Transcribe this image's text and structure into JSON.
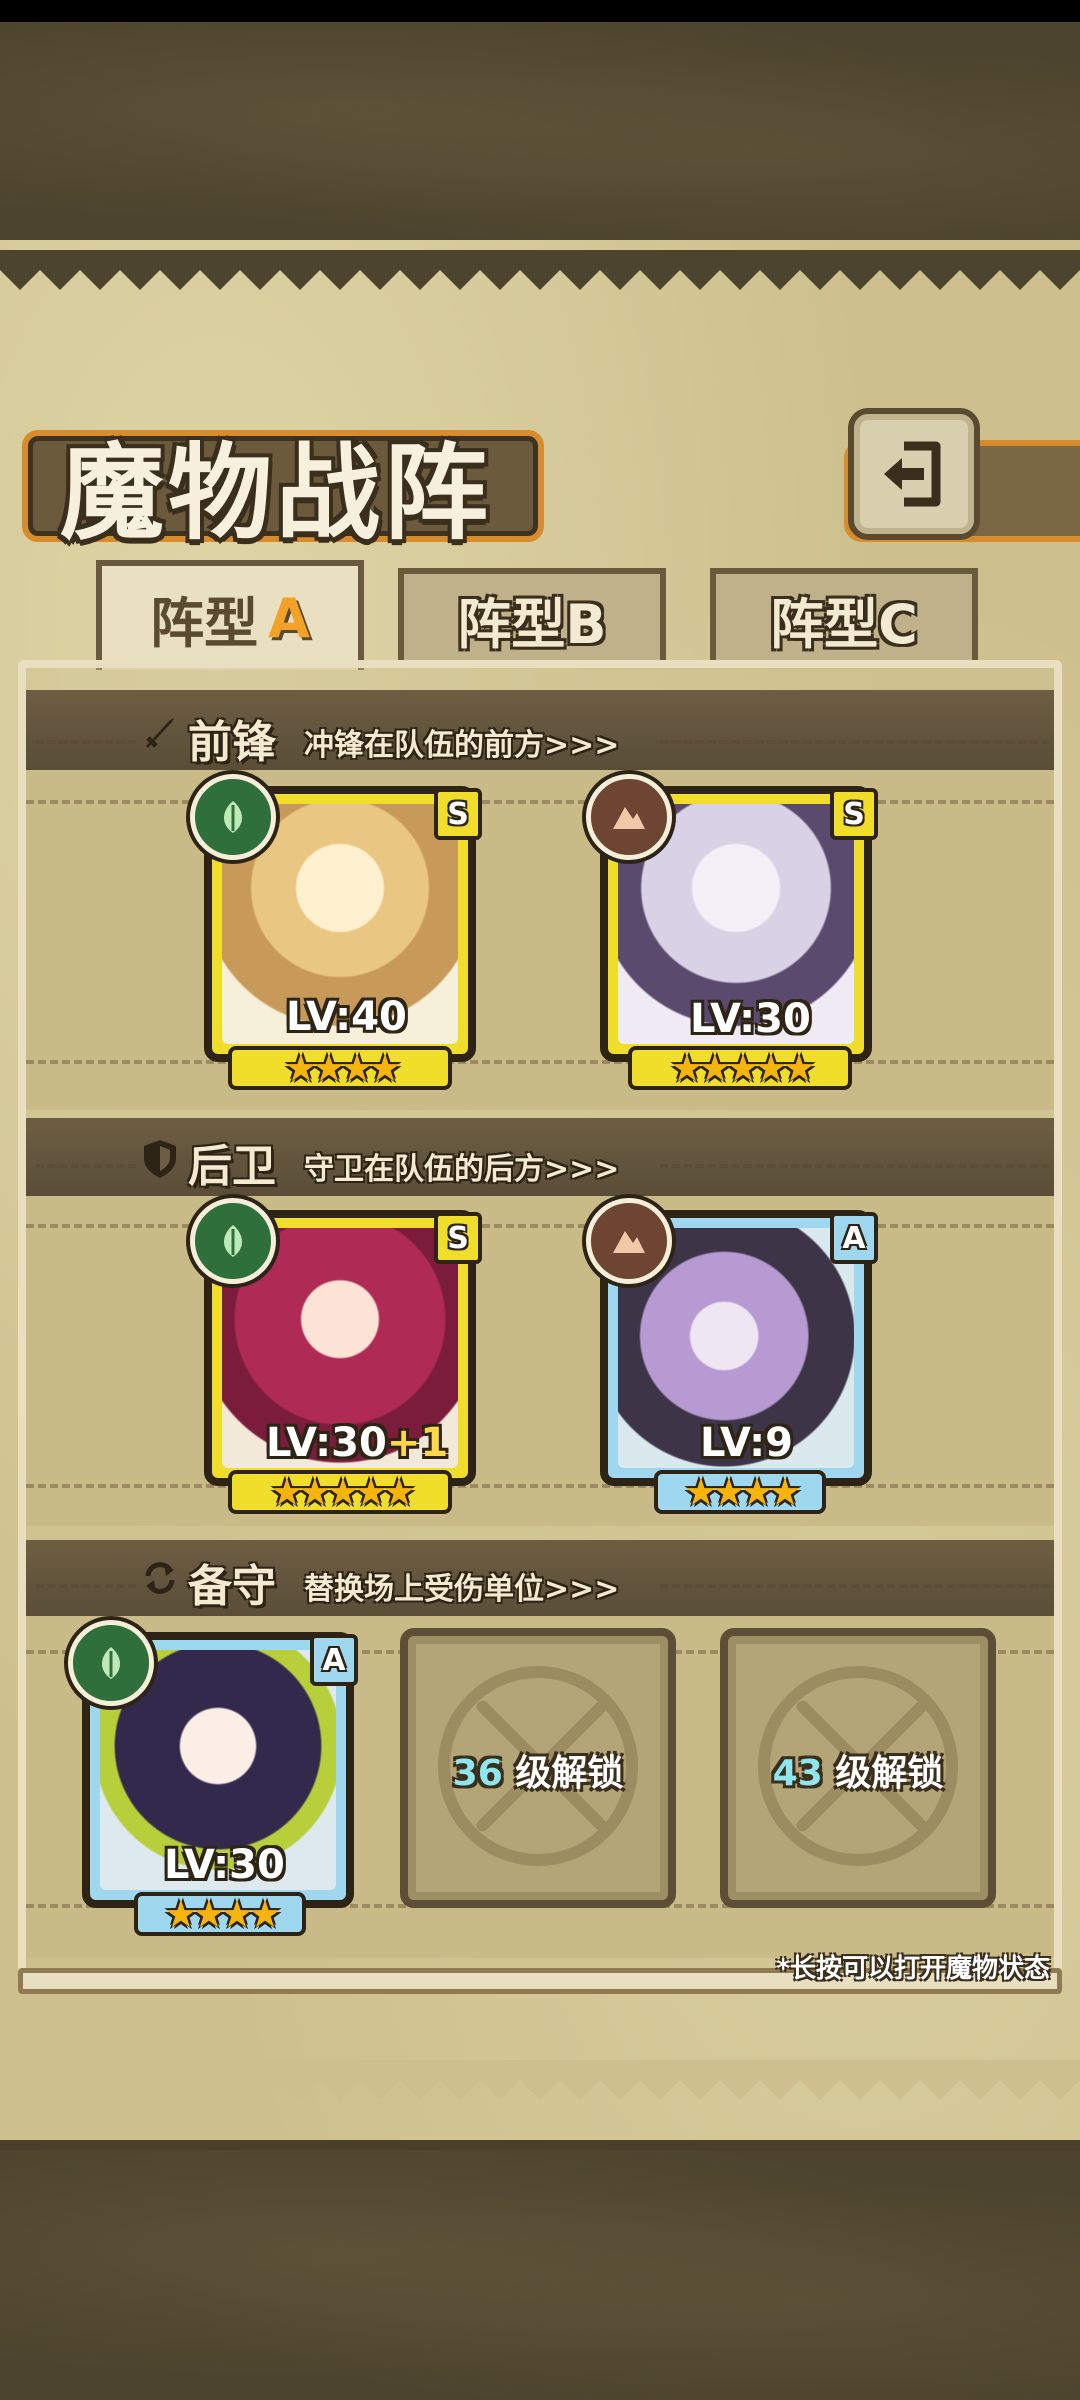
{
  "title": "魔物战阵",
  "tabs": {
    "a": {
      "label": "阵型",
      "letter": "A"
    },
    "b": {
      "label": "阵型B"
    },
    "c": {
      "label": "阵型C"
    }
  },
  "sections": {
    "front": {
      "title": "前锋",
      "subtitle": "冲锋在队伍的前方>>>"
    },
    "rear": {
      "title": "后卫",
      "subtitle": "守卫在队伍的后方>>>"
    },
    "reserve": {
      "title": "备守",
      "subtitle": "替换场上受伤单位>>>"
    }
  },
  "units": {
    "front1": {
      "rank": "S",
      "element": "leaf",
      "level": "LV:40",
      "bonus": "",
      "stars": "★★★★"
    },
    "front2": {
      "rank": "S",
      "element": "rock",
      "level": "LV:30",
      "bonus": "",
      "stars": "★★★★★"
    },
    "rear1": {
      "rank": "S",
      "element": "leaf",
      "level": "LV:30",
      "bonus": "+1",
      "stars": "★★★★★"
    },
    "rear2": {
      "rank": "A",
      "element": "rock",
      "level": "LV:9",
      "bonus": "",
      "stars": "★★★★"
    },
    "reserve1": {
      "rank": "A",
      "element": "leaf",
      "level": "LV:30",
      "bonus": "",
      "stars": "★★★★"
    }
  },
  "locked_slots": [
    {
      "level": "36",
      "text": "级解锁"
    },
    {
      "level": "43",
      "text": "级解锁"
    }
  ],
  "hint": "*长按可以打开魔物状态",
  "colors": {
    "accent_orange": "#d78c2e",
    "rank_s": "#f1de2a",
    "rank_a": "#9fd7ee",
    "unlock_cyan": "#8ee6ef"
  }
}
